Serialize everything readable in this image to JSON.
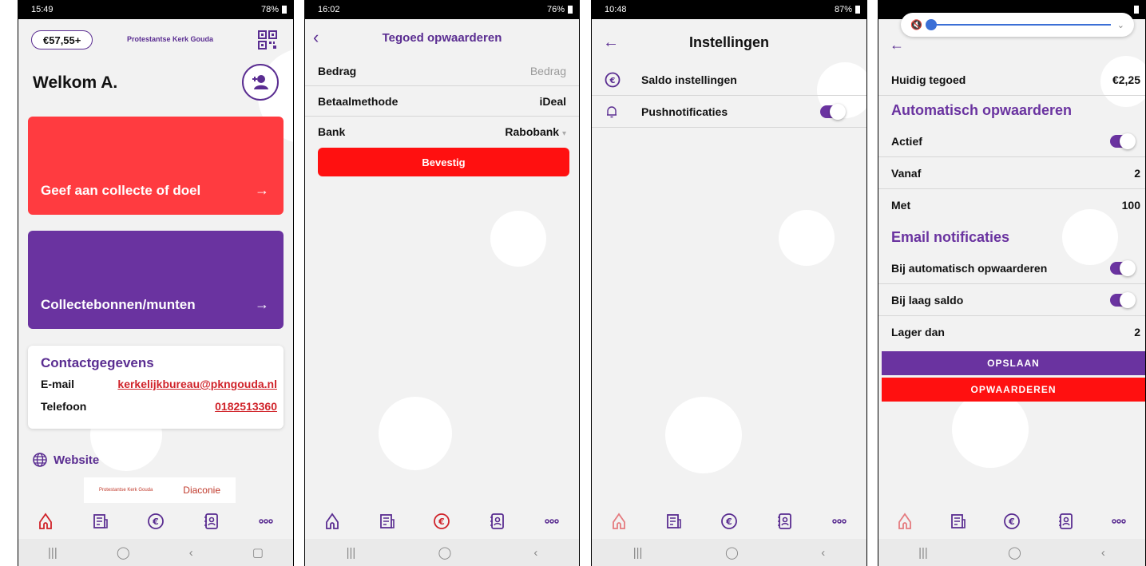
{
  "phone1": {
    "status_time": "15:49",
    "status_battery": "78%",
    "balance": "€57,55+",
    "org_name": "Protestantse Kerk Gouda",
    "welcome": "Welkom A.",
    "card_give": "Geef aan collecte of doel",
    "card_coins": "Collectebonnen/munten",
    "contact_title": "Contactgegevens",
    "email_label": "E-mail",
    "email_value": "kerkelijkbureau@pkngouda.nl",
    "phone_label": "Telefoon",
    "phone_value": "0182513360",
    "website": "Website",
    "logo_left": "Protestantse Kerk Gouda",
    "logo_right": "Diaconie"
  },
  "phone2": {
    "status_time": "16:02",
    "status_battery": "76%",
    "title": "Tegoed opwaarderen",
    "amount_label": "Bedrag",
    "amount_placeholder": "Bedrag",
    "method_label": "Betaalmethode",
    "method_value": "iDeal",
    "bank_label": "Bank",
    "bank_value": "Rabobank",
    "confirm": "Bevestig"
  },
  "phone3": {
    "status_time": "10:48",
    "status_battery": "87%",
    "title": "Instellingen",
    "saldo": "Saldo instellingen",
    "push": "Pushnotificaties"
  },
  "phone4": {
    "current_label": "Huidig tegoed",
    "current_value": "€2,25",
    "auto_section": "Automatisch opwaarderen",
    "active_label": "Actief",
    "from_label": "Vanaf",
    "from_value": "2",
    "with_label": "Met",
    "with_value": "100",
    "email_section": "Email notificaties",
    "on_auto_label": "Bij automatisch opwaarderen",
    "on_low_label": "Bij laag saldo",
    "lower_label": "Lager dan",
    "lower_value": "2",
    "save": "OPSLAAN",
    "topup": "OPWAARDEREN"
  },
  "colors": {
    "purple": "#6a33a0",
    "red": "#ff3b40",
    "button_red": "#ff1010"
  },
  "nav_icons": [
    "church-icon",
    "news-icon",
    "euro-icon",
    "contacts-icon",
    "more-icon"
  ]
}
